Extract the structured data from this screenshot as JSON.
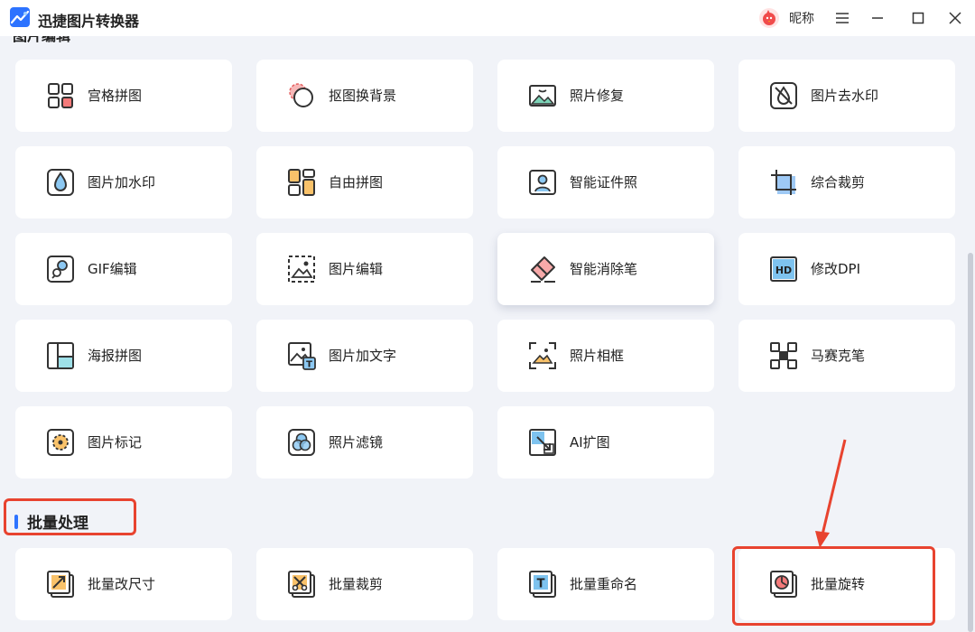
{
  "app": {
    "title": "迅捷图片转换器",
    "nickname": "昵称"
  },
  "section1": {
    "title": "图片编辑"
  },
  "cards": [
    {
      "label": "宫格拼图",
      "icon": "grid-collage-icon"
    },
    {
      "label": "抠图换背景",
      "icon": "cutout-icon"
    },
    {
      "label": "照片修复",
      "icon": "photo-repair-icon"
    },
    {
      "label": "图片去水印",
      "icon": "remove-watermark-icon"
    },
    {
      "label": "图片加水印",
      "icon": "add-watermark-icon"
    },
    {
      "label": "自由拼图",
      "icon": "free-collage-icon"
    },
    {
      "label": "智能证件照",
      "icon": "id-photo-icon"
    },
    {
      "label": "综合裁剪",
      "icon": "crop-icon"
    },
    {
      "label": "GIF编辑",
      "icon": "gif-edit-icon"
    },
    {
      "label": "图片编辑",
      "icon": "image-edit-icon"
    },
    {
      "label": "智能消除笔",
      "icon": "eraser-pen-icon"
    },
    {
      "label": "修改DPI",
      "icon": "hd-dpi-icon"
    },
    {
      "label": "海报拼图",
      "icon": "poster-collage-icon"
    },
    {
      "label": "图片加文字",
      "icon": "add-text-icon"
    },
    {
      "label": "照片相框",
      "icon": "photo-frame-icon"
    },
    {
      "label": "马赛克笔",
      "icon": "mosaic-icon"
    },
    {
      "label": "图片标记",
      "icon": "image-mark-icon"
    },
    {
      "label": "照片滤镜",
      "icon": "photo-filter-icon"
    },
    {
      "label": "AI扩图",
      "icon": "ai-expand-icon"
    }
  ],
  "section2": {
    "title": "批量处理"
  },
  "batch_cards": [
    {
      "label": "批量改尺寸",
      "icon": "batch-resize-icon"
    },
    {
      "label": "批量裁剪",
      "icon": "batch-crop-icon"
    },
    {
      "label": "批量重命名",
      "icon": "batch-rename-icon"
    },
    {
      "label": "批量旋转",
      "icon": "batch-rotate-icon"
    }
  ],
  "colors": {
    "accent": "#2d73ff",
    "highlight": "#e8432f",
    "background": "#f1f3f8",
    "card": "#ffffff"
  }
}
